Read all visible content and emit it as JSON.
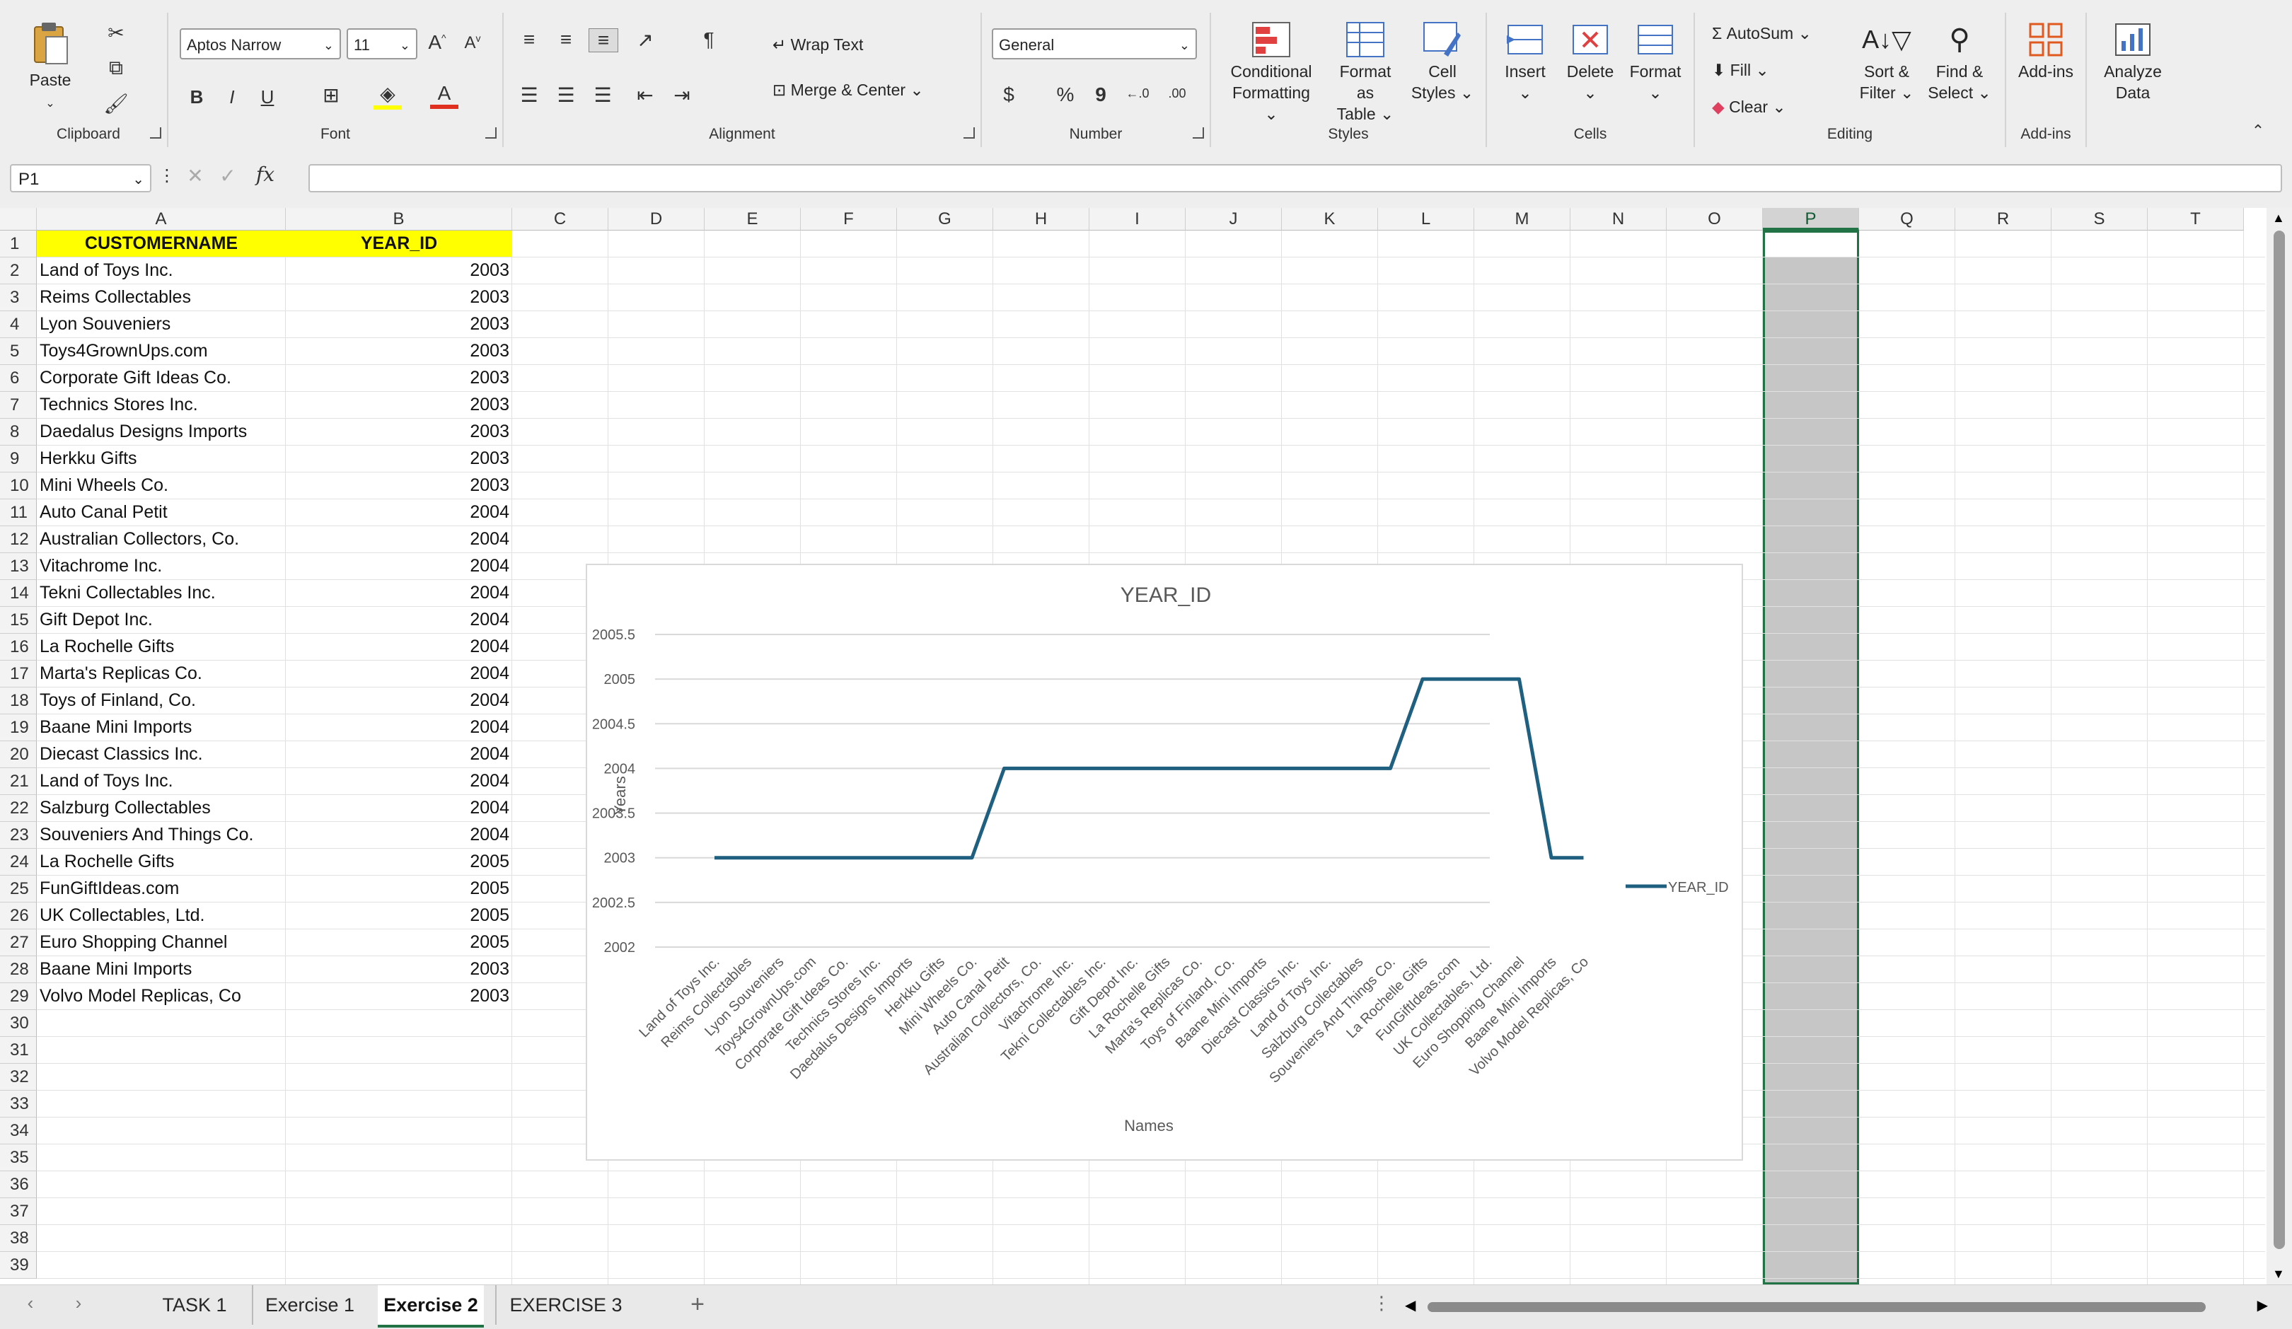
{
  "ribbon": {
    "clipboard": {
      "label": "Clipboard",
      "paste": "Paste"
    },
    "font": {
      "label": "Font",
      "name": "Aptos Narrow",
      "size": "11",
      "bold": "B",
      "italic": "I",
      "underline": "U"
    },
    "alignment": {
      "label": "Alignment",
      "wrap": "Wrap Text",
      "merge": "Merge & Center"
    },
    "number": {
      "label": "Number",
      "format": "General",
      "currency": "$",
      "percent": "%",
      "comma": "9"
    },
    "styles": {
      "label": "Styles",
      "conditional_1": "Conditional",
      "conditional_2": "Formatting",
      "format_table_1": "Format as",
      "format_table_2": "Table",
      "cell_styles_1": "Cell",
      "cell_styles_2": "Styles"
    },
    "cells": {
      "label": "Cells",
      "insert": "Insert",
      "delete": "Delete",
      "format": "Format"
    },
    "editing": {
      "label": "Editing",
      "autosum": "AutoSum",
      "fill": "Fill",
      "clear": "Clear",
      "sort_1": "Sort &",
      "sort_2": "Filter",
      "find_1": "Find &",
      "find_2": "Select"
    },
    "addins": {
      "label": "Add-ins",
      "addins": "Add-ins",
      "analyze_1": "Analyze",
      "analyze_2": "Data"
    }
  },
  "formula_bar": {
    "name_box": "P1",
    "fx": "fx",
    "value": ""
  },
  "columns": [
    "A",
    "B",
    "C",
    "D",
    "E",
    "F",
    "G",
    "H",
    "I",
    "J",
    "K",
    "L",
    "M",
    "N",
    "O",
    "P",
    "Q",
    "R",
    "S",
    "T"
  ],
  "headers": {
    "a": "CUSTOMERNAME",
    "b": "YEAR_ID"
  },
  "rows": [
    {
      "name": "Land of Toys Inc.",
      "year": 2003
    },
    {
      "name": "Reims Collectables",
      "year": 2003
    },
    {
      "name": "Lyon Souveniers",
      "year": 2003
    },
    {
      "name": "Toys4GrownUps.com",
      "year": 2003
    },
    {
      "name": "Corporate Gift Ideas Co.",
      "year": 2003
    },
    {
      "name": "Technics Stores Inc.",
      "year": 2003
    },
    {
      "name": "Daedalus Designs Imports",
      "year": 2003
    },
    {
      "name": "Herkku Gifts",
      "year": 2003
    },
    {
      "name": "Mini Wheels Co.",
      "year": 2003
    },
    {
      "name": "Auto Canal Petit",
      "year": 2004
    },
    {
      "name": "Australian Collectors, Co.",
      "year": 2004
    },
    {
      "name": "Vitachrome Inc.",
      "year": 2004
    },
    {
      "name": "Tekni Collectables Inc.",
      "year": 2004
    },
    {
      "name": "Gift Depot Inc.",
      "year": 2004
    },
    {
      "name": "La Rochelle Gifts",
      "year": 2004
    },
    {
      "name": "Marta's Replicas Co.",
      "year": 2004
    },
    {
      "name": "Toys of Finland, Co.",
      "year": 2004
    },
    {
      "name": "Baane Mini Imports",
      "year": 2004
    },
    {
      "name": "Diecast Classics Inc.",
      "year": 2004
    },
    {
      "name": "Land of Toys Inc.",
      "year": 2004
    },
    {
      "name": "Salzburg Collectables",
      "year": 2004
    },
    {
      "name": "Souveniers And Things Co.",
      "year": 2004
    },
    {
      "name": "La Rochelle Gifts",
      "year": 2005
    },
    {
      "name": "FunGiftIdeas.com",
      "year": 2005
    },
    {
      "name": "UK Collectables, Ltd.",
      "year": 2005
    },
    {
      "name": "Euro Shopping Channel",
      "year": 2005
    },
    {
      "name": "Baane Mini Imports",
      "year": 2003
    },
    {
      "name": "Volvo Model Replicas, Co",
      "year": 2003
    }
  ],
  "chart_data": {
    "type": "line",
    "title": "YEAR_ID",
    "xlabel": "Names",
    "ylabel": "Years",
    "ylim": [
      2002,
      2005.5
    ],
    "yticks": [
      "2002",
      "2002.5",
      "2003",
      "2003.5",
      "2004",
      "2004.5",
      "2005",
      "2005.5"
    ],
    "legend": "right",
    "grid": true,
    "color": "#1f5f7f",
    "series": [
      {
        "name": "YEAR_ID",
        "values": [
          2003,
          2003,
          2003,
          2003,
          2003,
          2003,
          2003,
          2003,
          2003,
          2004,
          2004,
          2004,
          2004,
          2004,
          2004,
          2004,
          2004,
          2004,
          2004,
          2004,
          2004,
          2004,
          2005,
          2005,
          2005,
          2005,
          2003,
          2003
        ]
      }
    ],
    "categories": [
      "Land of Toys Inc.",
      "Reims Collectables",
      "Lyon Souveniers",
      "Toys4GrownUps.com",
      "Corporate Gift Ideas Co.",
      "Technics Stores Inc.",
      "Daedalus Designs Imports",
      "Herkku Gifts",
      "Mini Wheels Co.",
      "Auto Canal Petit",
      "Australian Collectors, Co.",
      "Vitachrome Inc.",
      "Tekni Collectables Inc.",
      "Gift Depot Inc.",
      "La Rochelle Gifts",
      "Marta's Replicas Co.",
      "Toys of Finland, Co.",
      "Baane Mini Imports",
      "Diecast Classics Inc.",
      "Land of Toys Inc.",
      "Salzburg Collectables",
      "Souveniers And Things Co.",
      "La Rochelle Gifts",
      "FunGiftIdeas.com",
      "UK Collectables, Ltd.",
      "Euro Shopping Channel",
      "Baane Mini Imports",
      "Volvo Model Replicas, Co"
    ]
  },
  "sheet_tabs": [
    "TASK 1",
    "Exercise 1",
    "Exercise 2",
    "EXERCISE 3"
  ],
  "active_tab": "Exercise 2",
  "colors": {
    "header_fill": "#ffff00",
    "selected_col": "#c6c6c6",
    "accent": "#217346"
  }
}
